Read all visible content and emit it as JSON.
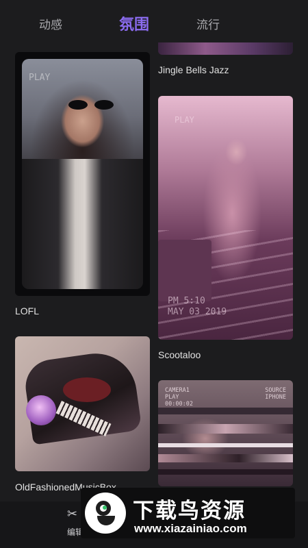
{
  "tabs": [
    {
      "label": "动感"
    },
    {
      "label": "氛围"
    },
    {
      "label": "流行"
    }
  ],
  "active_tab_color": "#8b6cf0",
  "effects": [
    {
      "title": "Jingle Bells Jazz"
    },
    {
      "title": "LOFL",
      "overlay_text": "PLAY"
    },
    {
      "title": "Scootaloo",
      "overlay_text": "PLAY",
      "stamp": "PM 5:10\nMAY 03 2019"
    },
    {
      "title": "OldFashionedMusicBox"
    },
    {
      "title": "",
      "hud_left": "CAMERA1\nPLAY\n00:00:02",
      "hud_right": "SOURCE\nIPHONE"
    }
  ],
  "bottom_nav": {
    "icon": "scissors-icon",
    "label": "编辑"
  },
  "watermark": {
    "title": "下载鸟资源",
    "url": "www.xiazainiao.com"
  }
}
